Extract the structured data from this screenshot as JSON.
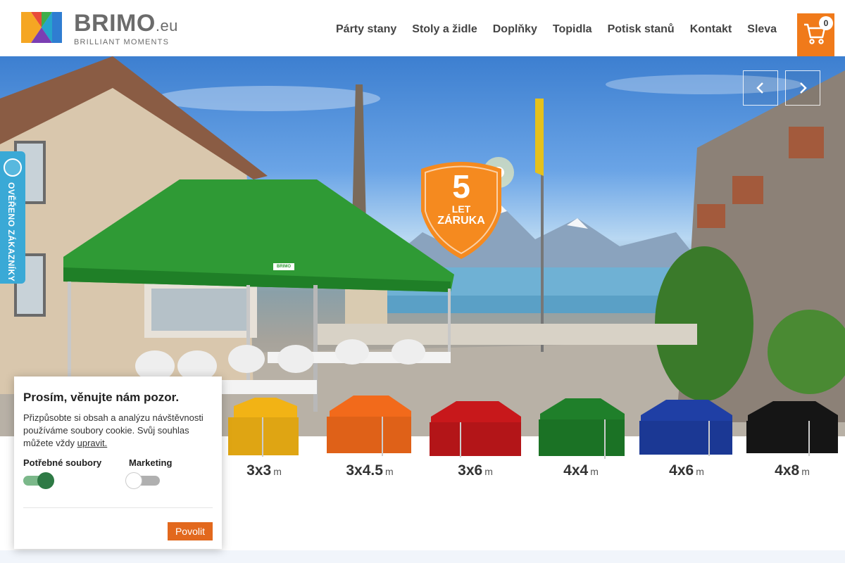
{
  "header": {
    "logo": {
      "brand": "BRIMO",
      "suffix": ".eu",
      "tagline": "BRILLIANT MOMENTS"
    },
    "nav": [
      "Párty stany",
      "Stoly a židle",
      "Doplňky",
      "Topidla",
      "Potisk stanů",
      "Kontakt",
      "Sleva"
    ],
    "cart": {
      "count": "0",
      "color": "#f07a1a"
    }
  },
  "hero": {
    "badge": {
      "number": "5",
      "line1": "LET",
      "line2": "ZÁRUKA"
    },
    "tent_label": "BRIMO"
  },
  "verified_badge": {
    "text": "OVĚŘENO ZÁKAZNÍKY"
  },
  "sizes": [
    {
      "label": "3x3",
      "unit": "m",
      "color": "#f2b315"
    },
    {
      "label": "3x4.5",
      "unit": "m",
      "color": "#f26a1b"
    },
    {
      "label": "3x6",
      "unit": "m",
      "color": "#c8181b"
    },
    {
      "label": "4x4",
      "unit": "m",
      "color": "#1f7f2a"
    },
    {
      "label": "4x6",
      "unit": "m",
      "color": "#1f3fa5"
    },
    {
      "label": "4x8",
      "unit": "m",
      "color": "#151515"
    }
  ],
  "cookie": {
    "title": "Prosím, věnujte nám pozor.",
    "text": "Přizpůsobte si obsah a analýzu návštěvnosti používáme soubory cookie. Svůj souhlas můžete vždy",
    "link": "upravit.",
    "options": [
      {
        "label": "Potřebné soubory",
        "checked": true
      },
      {
        "label": "Marketing",
        "checked": false
      }
    ],
    "button": "Povolit"
  }
}
